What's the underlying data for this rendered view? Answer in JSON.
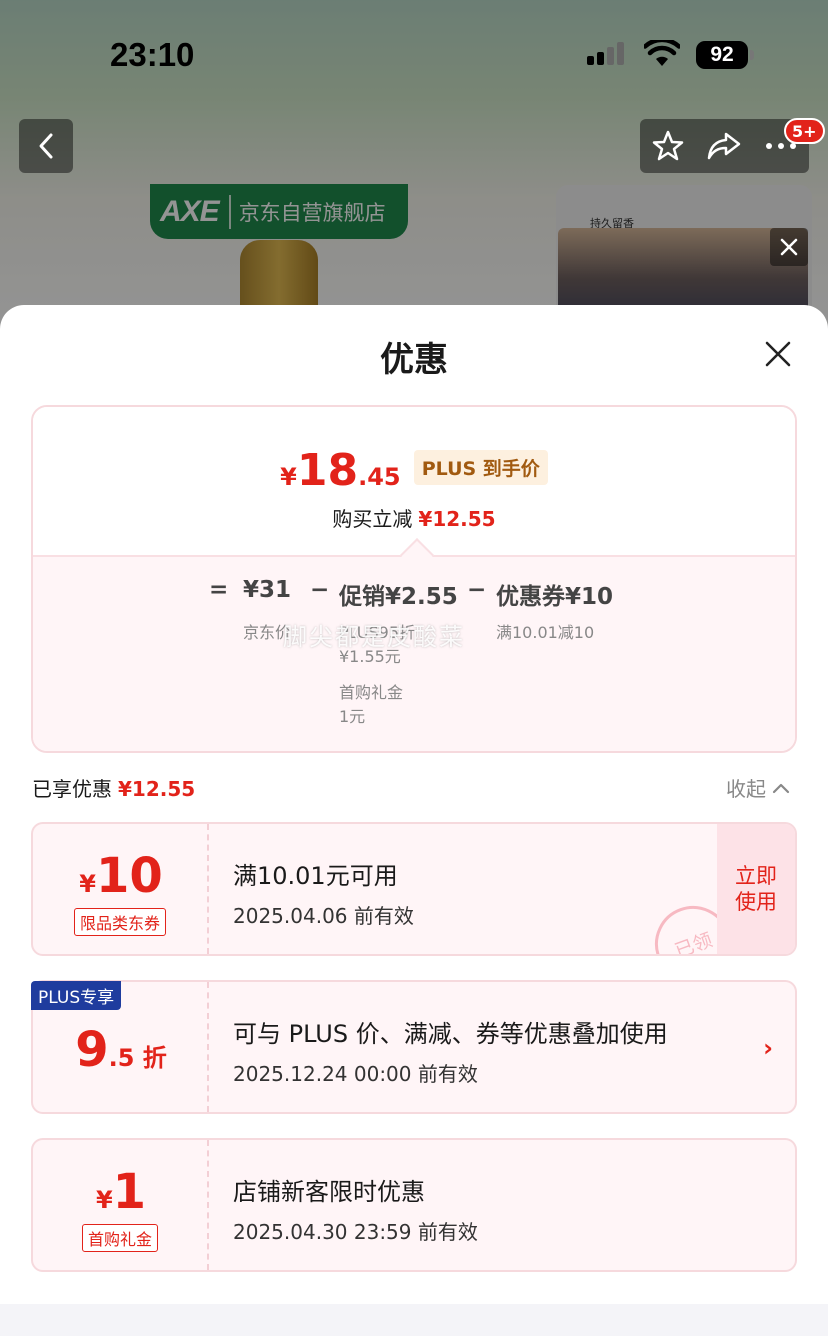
{
  "status_bar": {
    "time": "23:10",
    "battery": "92"
  },
  "background": {
    "store_logo": "AXE",
    "store_name": "京东自营旗舰店",
    "cart_badge": "5+",
    "side_card_label": "持久留香"
  },
  "sheet": {
    "title": "优惠",
    "summary": {
      "currency": "¥",
      "price_int": "18",
      "price_dec": ".45",
      "price_tag": "PLUS 到手价",
      "reduce_label": "购买立减",
      "reduce_value": "¥12.55",
      "formula": {
        "equals": "=",
        "base_value": "¥31",
        "base_label": "京东价",
        "minus1": "−",
        "promo": "促销¥2.55",
        "promo_detail1_label": "PLUS95折",
        "promo_detail1_value": "¥1.55元",
        "promo_detail2_label": "首购礼金",
        "promo_detail2_value": "1元",
        "minus2": "−",
        "coupon": "优惠券¥10",
        "coupon_detail": "满10.01减10"
      },
      "watermark": "脚尖都是皮酸菜"
    },
    "enjoyed_label": "已享优惠",
    "enjoyed_value": "¥12.55",
    "collapse_label": "收起",
    "coupons": [
      {
        "currency": "¥",
        "amount": "10",
        "tag": "限品类东券",
        "main": "满10.01元可用",
        "sub": "2025.04.06 前有效",
        "button_line1": "立即",
        "button_line2": "使用",
        "stamp": "已领"
      },
      {
        "badge": "PLUS专享",
        "amount": "9",
        "amount_suffix": ".5 折",
        "main": "可与 PLUS 价、满减、券等优惠叠加使用",
        "sub": "2025.12.24 00:00 前有效"
      },
      {
        "currency": "¥",
        "amount": "1",
        "tag": "首购礼金",
        "main": "店铺新客限时优惠",
        "sub": "2025.04.30 23:59 前有效"
      }
    ]
  },
  "colors": {
    "accent_red": "#e2231a",
    "plus_blue": "#1f3c9e",
    "brand_green": "#1f8a4c"
  }
}
